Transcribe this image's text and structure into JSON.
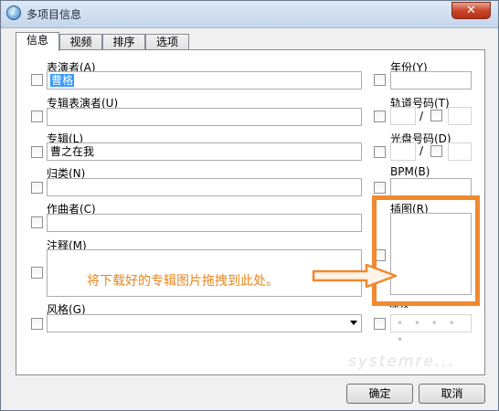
{
  "window": {
    "title": "多项目信息",
    "close_glyph": "✕",
    "icon": "itunes-icon"
  },
  "tabs": [
    {
      "label": "信息",
      "active": true
    },
    {
      "label": "视频",
      "active": false
    },
    {
      "label": "排序",
      "active": false
    },
    {
      "label": "选项",
      "active": false
    }
  ],
  "fields": {
    "artist": {
      "label": "表演者(A)",
      "value": "曹格"
    },
    "album_artist": {
      "label": "专辑表演者(U)",
      "value": ""
    },
    "album": {
      "label": "专辑(L)",
      "value": "曹之在我"
    },
    "grouping": {
      "label": "归类(N)",
      "value": ""
    },
    "composer": {
      "label": "作曲者(C)",
      "value": ""
    },
    "comments": {
      "label": "注释(M)",
      "value": ""
    },
    "genre": {
      "label": "风格(G)",
      "value": ""
    },
    "year": {
      "label": "年份(Y)",
      "value": ""
    },
    "track": {
      "label": "轨道号码(T)",
      "separator": "/"
    },
    "disc": {
      "label": "光盘号码(D)",
      "separator": "/"
    },
    "bpm": {
      "label": "BPM(B)",
      "value": ""
    },
    "artwork": {
      "label": "插图(R)"
    },
    "rating": {
      "label": "评价",
      "stars": "• • • • •"
    }
  },
  "annotation": {
    "text": "将下载好的专辑图片拖拽到此处。",
    "color": "#f0892f"
  },
  "buttons": {
    "ok": "确定",
    "cancel": "取消"
  },
  "watermark": "systemre..."
}
